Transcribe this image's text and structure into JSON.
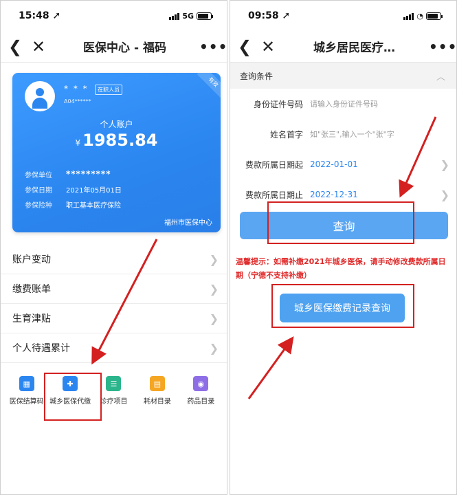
{
  "left": {
    "status": {
      "time": "15:48 ➚",
      "network": "5G"
    },
    "nav": {
      "back": "❮",
      "close": "✕",
      "title": "医保中心 - 福码",
      "more": "•••"
    },
    "card": {
      "name": "* * *",
      "tag": "在职人员",
      "id": "A04******",
      "corner": "有效",
      "account_label": "个人账户",
      "currency": "¥",
      "balance": "1985.84",
      "rows": [
        {
          "key": "参保单位",
          "value": "*********"
        },
        {
          "key": "参保日期",
          "value": "2021年05月01日"
        },
        {
          "key": "参保险种",
          "value": "职工基本医疗保险"
        }
      ],
      "footer": "福州市医保中心"
    },
    "menu": [
      {
        "label": "账户变动"
      },
      {
        "label": "缴费账单"
      },
      {
        "label": "生育津贴"
      },
      {
        "label": "个人待遇累计"
      }
    ],
    "grid": [
      {
        "label": "医保结算码",
        "icon": "qr-icon",
        "color": "#2b86f0"
      },
      {
        "label": "城乡医保代缴",
        "icon": "bag-icon",
        "color": "#2b86f0"
      },
      {
        "label": "诊疗项目",
        "icon": "clipboard-icon",
        "color": "#2bb58c"
      },
      {
        "label": "耗材目录",
        "icon": "box-icon",
        "color": "#f5a623"
      },
      {
        "label": "药品目录",
        "icon": "pill-icon",
        "color": "#8e6ee6"
      }
    ]
  },
  "right": {
    "status": {
      "time": "09:58 ➚"
    },
    "nav": {
      "back": "❮",
      "close": "✕",
      "title": "城乡居民医疗…",
      "more": "•••"
    },
    "section": {
      "title": "查询条件"
    },
    "fields": [
      {
        "label": "身份证件号码",
        "value": "请输入身份证件号码"
      },
      {
        "label": "姓名首字",
        "value": "如\"张三\",输入一个\"张\"字"
      },
      {
        "label": "费款所属日期起",
        "value": "2022-01-01"
      },
      {
        "label": "费款所属日期止",
        "value": "2022-12-31"
      }
    ],
    "query_button": "查询",
    "tip": "温馨提示：如需补缴2021年城乡医保，请手动修改费款所属日期（宁德不支持补缴）",
    "record_button": "城乡医保缴费记录查询"
  },
  "colors": {
    "accent": "#2b86f0",
    "annotation": "#d42020",
    "tip": "#e02a2a"
  }
}
